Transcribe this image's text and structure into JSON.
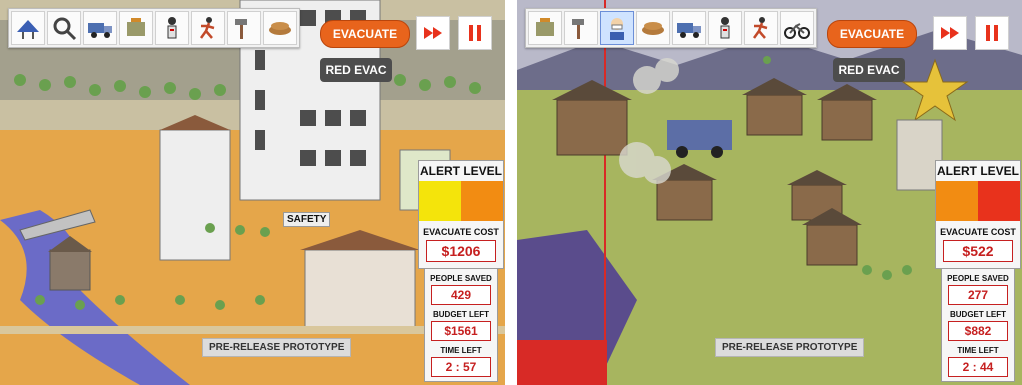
{
  "left": {
    "tools": [
      {
        "icon": "solar-panel-icon"
      },
      {
        "icon": "magnifier-icon"
      },
      {
        "icon": "truck-icon"
      },
      {
        "icon": "generator-icon"
      },
      {
        "icon": "first-aid-icon"
      },
      {
        "icon": "runner-icon"
      },
      {
        "icon": "hammer-icon"
      },
      {
        "icon": "sandbag-icon"
      }
    ],
    "evacuate_label": "EVACUATE",
    "red_evac_label": "RED EVAC",
    "fast_forward_icon": "fast-forward-icon",
    "pause_icon": "pause-icon",
    "alert_title": "ALERT LEVEL",
    "alert_colors": [
      "#f4e40b",
      "#f28c12"
    ],
    "evacuate_cost_label": "EVACUATE COST",
    "evacuate_cost": "$1206",
    "people_saved_label": "PEOPLE SAVED",
    "people_saved": "429",
    "budget_left_label": "BUDGET LEFT",
    "budget_left": "$1561",
    "time_left_label": "TIME LEFT",
    "time_left": "2 : 57",
    "safety_label": "SAFETY",
    "prototype_label": "PRE-RELEASE PROTOTYPE"
  },
  "right": {
    "tools": [
      {
        "icon": "generator-icon"
      },
      {
        "icon": "hammer-icon"
      },
      {
        "icon": "mask-person-icon"
      },
      {
        "icon": "sandbag-icon"
      },
      {
        "icon": "truck-icon"
      },
      {
        "icon": "first-aid-icon"
      },
      {
        "icon": "runner-icon"
      },
      {
        "icon": "motorbike-icon"
      }
    ],
    "selected_tool_index": 2,
    "evacuate_label": "EVACUATE",
    "red_evac_label": "RED EVAC",
    "fast_forward_icon": "fast-forward-icon",
    "pause_icon": "pause-icon",
    "alert_title": "ALERT LEVEL",
    "alert_colors": [
      "#f28c12",
      "#e8321c"
    ],
    "evacuate_cost_label": "EVACUATE COST",
    "evacuate_cost": "$522",
    "people_saved_label": "PEOPLE SAVED",
    "people_saved": "277",
    "budget_left_label": "BUDGET LEFT",
    "budget_left": "$882",
    "time_left_label": "TIME LEFT",
    "time_left": "2 : 44",
    "prototype_label": "PRE-RELEASE PROTOTYPE"
  }
}
